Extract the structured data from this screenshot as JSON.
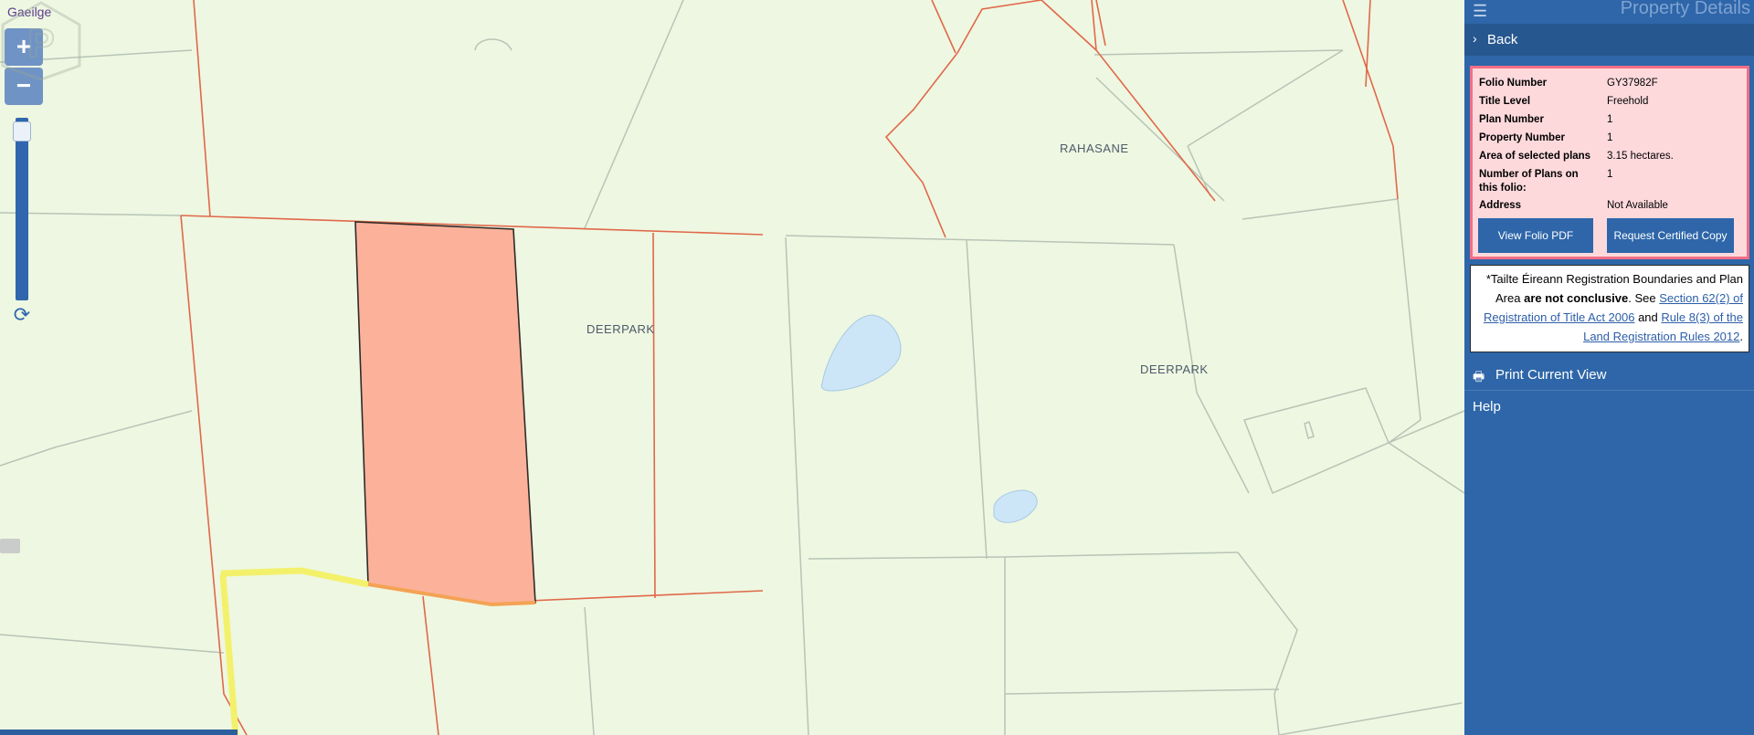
{
  "map": {
    "language_link": "Gaeilge",
    "zoom_in": "+",
    "zoom_out": "−",
    "labels": [
      "RAHASANE",
      "DEERPARK",
      "DEERPARK"
    ],
    "colors": {
      "background": "#eef7e1",
      "boundary_red": "#e0684a",
      "boundary_grey": "#b7c4b7",
      "selected_fill": "#fcb29a",
      "water": "#cde6f7",
      "yellow_line": "#f3f16b"
    }
  },
  "panel": {
    "title": "Property Details",
    "back": "Back",
    "details": [
      {
        "key": "Folio Number",
        "value": "GY37982F"
      },
      {
        "key": "Title Level",
        "value": "Freehold"
      },
      {
        "key": "Plan Number",
        "value": "1"
      },
      {
        "key": "Property Number",
        "value": "1"
      },
      {
        "key": "Area of selected plans",
        "value": "3.15 hectares."
      },
      {
        "key": "Number of Plans on this folio:",
        "value": "1"
      },
      {
        "key": "Address",
        "value": "Not Available"
      }
    ],
    "buttons": {
      "folio_pdf": "View Folio PDF",
      "certified_copy": "Request Certified Copy"
    },
    "notice": {
      "part1": "*Tailte Éireann Registration Boundaries and Plan Area ",
      "bold": "are not conclusive",
      "part2": ". See ",
      "link1": "Section 62(2) of Registration of Title Act 2006",
      "part3": " and ",
      "link2": "Rule 8(3) of the Land Registration Rules 2012",
      "part4": "."
    },
    "print": "Print Current View",
    "help": "Help"
  }
}
